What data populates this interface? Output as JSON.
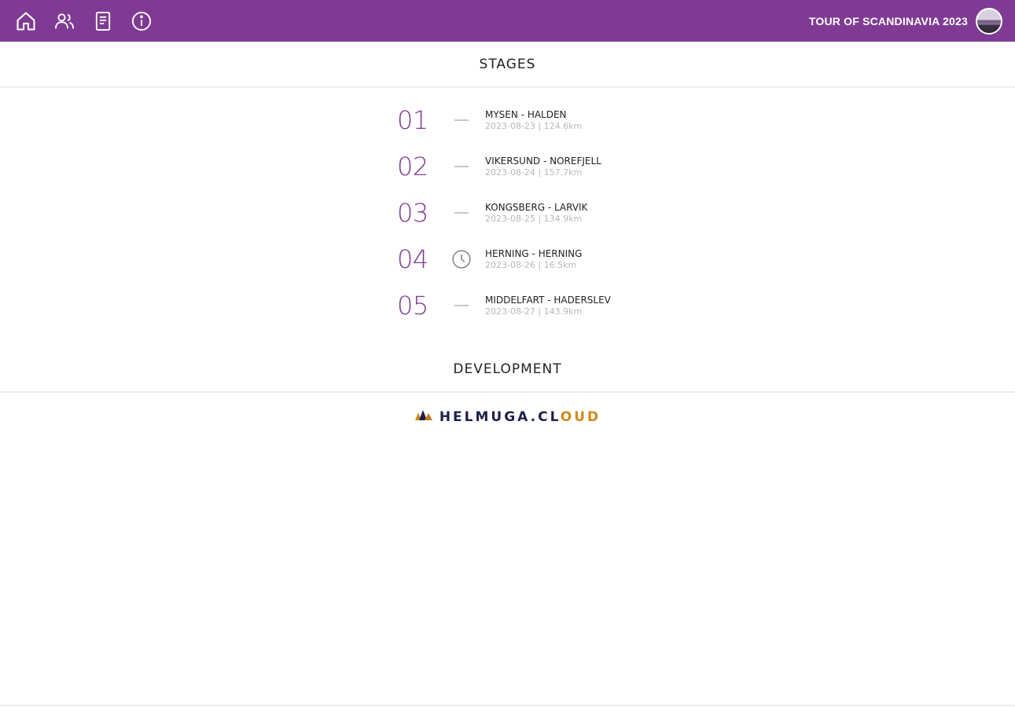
{
  "header": {
    "title": "TOUR OF SCANDINAVIA 2023",
    "bg_color": "#7f3b94",
    "nav": [
      {
        "name": "home",
        "icon": "home-icon"
      },
      {
        "name": "riders",
        "icon": "users-icon"
      },
      {
        "name": "results",
        "icon": "document-icon"
      },
      {
        "name": "info",
        "icon": "info-icon"
      }
    ]
  },
  "stages_section": {
    "title": "STAGES",
    "items": [
      {
        "number": "01",
        "name": "MYSEN - HALDEN",
        "meta": "2023-08-23 | 124.6km",
        "status_icon": "dash"
      },
      {
        "number": "02",
        "name": "VIKERSUND - NOREFJELL",
        "meta": "2023-08-24 | 157.7km",
        "status_icon": "dash"
      },
      {
        "number": "03",
        "name": "KONGSBERG - LARVIK",
        "meta": "2023-08-25 | 134.9km",
        "status_icon": "dash"
      },
      {
        "number": "04",
        "name": "HERNING - HERNING",
        "meta": "2023-08-26 | 16.5km",
        "status_icon": "clock-icon"
      },
      {
        "number": "05",
        "name": "MIDDELFART - HADERSLEV",
        "meta": "2023-08-27 | 143.9km",
        "status_icon": "dash"
      }
    ]
  },
  "development_section": {
    "title": "DEVELOPMENT",
    "logo": {
      "text_main": "HELMUGA.CL",
      "text_accent": "OUD",
      "accent_color": "#d08a1d"
    }
  }
}
